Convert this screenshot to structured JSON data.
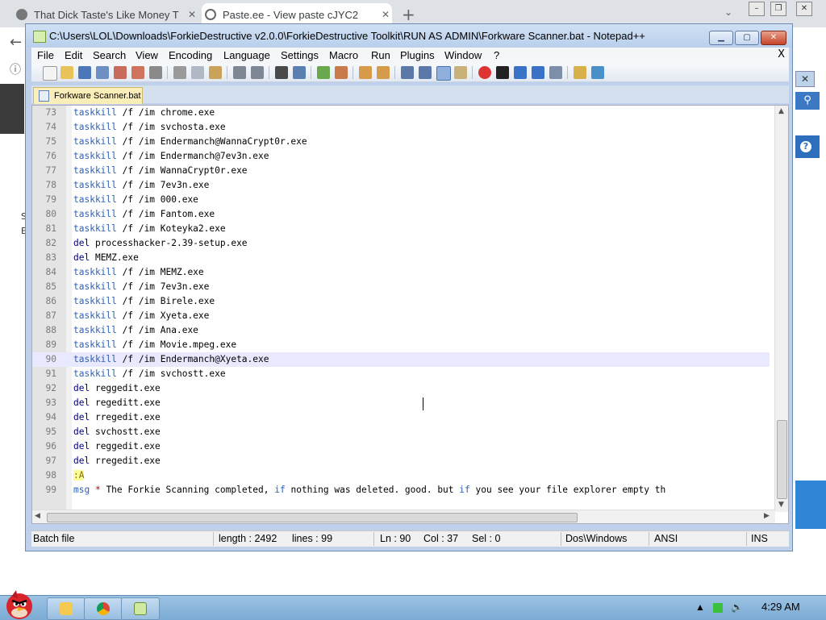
{
  "browser": {
    "tabs": [
      {
        "label": "That Dick Taste's Like Money T"
      },
      {
        "label": "Paste.ee - View paste cJYC2"
      }
    ]
  },
  "window": {
    "title": "C:\\Users\\LOL\\Downloads\\ForkieDestructive v2.0.0\\ForkieDestructive Toolkit\\RUN AS ADMIN\\Forkware Scanner.bat - Notepad++"
  },
  "menu": [
    "File",
    "Edit",
    "Search",
    "View",
    "Encoding",
    "Language",
    "Settings",
    "Macro",
    "Run",
    "Plugins",
    "Window",
    "?"
  ],
  "menu_close": "X",
  "tab": {
    "label": "Forkware Scanner.bat"
  },
  "editor": {
    "current_line": 90,
    "lines": [
      {
        "n": "73",
        "kw": "taskkill",
        "rest": " /f /im chrome.exe"
      },
      {
        "n": "74",
        "kw": "taskkill",
        "rest": " /f /im svchosta.exe"
      },
      {
        "n": "75",
        "kw": "taskkill",
        "rest": " /f /im Endermanch@WannaCrypt0r.exe"
      },
      {
        "n": "76",
        "kw": "taskkill",
        "rest": " /f /im Endermanch@7ev3n.exe"
      },
      {
        "n": "77",
        "kw": "taskkill",
        "rest": " /f /im WannaCrypt0r.exe"
      },
      {
        "n": "78",
        "kw": "taskkill",
        "rest": " /f /im 7ev3n.exe"
      },
      {
        "n": "79",
        "kw": "taskkill",
        "rest": " /f /im 000.exe"
      },
      {
        "n": "80",
        "kw": "taskkill",
        "rest": " /f /im Fantom.exe"
      },
      {
        "n": "81",
        "kw": "taskkill",
        "rest": " /f /im Koteyka2.exe"
      },
      {
        "n": "82",
        "kw": "del",
        "rest": " processhacker-2.39-setup.exe"
      },
      {
        "n": "83",
        "kw": "del",
        "rest": " MEMZ.exe"
      },
      {
        "n": "84",
        "kw": "taskkill",
        "rest": " /f /im MEMZ.exe"
      },
      {
        "n": "85",
        "kw": "taskkill",
        "rest": " /f /im 7ev3n.exe"
      },
      {
        "n": "86",
        "kw": "taskkill",
        "rest": " /f /im Birele.exe"
      },
      {
        "n": "87",
        "kw": "taskkill",
        "rest": " /f /im Xyeta.exe"
      },
      {
        "n": "88",
        "kw": "taskkill",
        "rest": " /f /im Ana.exe"
      },
      {
        "n": "89",
        "kw": "taskkill",
        "rest": " /f /im Movie.mpeg.exe"
      },
      {
        "n": "90",
        "kw": "taskkill",
        "rest": " /f /im Endermanch@Xyeta.exe"
      },
      {
        "n": "91",
        "kw": "taskkill",
        "rest": " /f /im svchostt.exe"
      },
      {
        "n": "92",
        "kw": "del",
        "rest": " reggedit.exe"
      },
      {
        "n": "93",
        "kw": "del",
        "rest": " regeditt.exe"
      },
      {
        "n": "94",
        "kw": "del",
        "rest": " rregedit.exe"
      },
      {
        "n": "95",
        "kw": "del",
        "rest": " svchostt.exe"
      },
      {
        "n": "96",
        "kw": "del",
        "rest": " reggedit.exe"
      },
      {
        "n": "97",
        "kw": "del",
        "rest": " rregedit.exe"
      },
      {
        "n": "98",
        "label": ":A"
      },
      {
        "n": "99",
        "kw": "msg",
        "star": " *",
        "rest": " The Forkie Scanning completed, if nothing was deleted. good. but if you see your file explorer empty th"
      }
    ]
  },
  "status": {
    "filetype": "Batch file",
    "length": "length : 2492",
    "lines": "lines : 99",
    "ln": "Ln : 90",
    "col": "Col : 37",
    "sel": "Sel : 0",
    "eol": "Dos\\Windows",
    "encoding": "ANSI",
    "mode": "INS"
  },
  "taskbar": {
    "clock": "4:29 AM"
  },
  "colors": {
    "keyword": "#2e5fb5",
    "current_line": "#e8e8ff",
    "label_bg": "#ffff9a"
  }
}
